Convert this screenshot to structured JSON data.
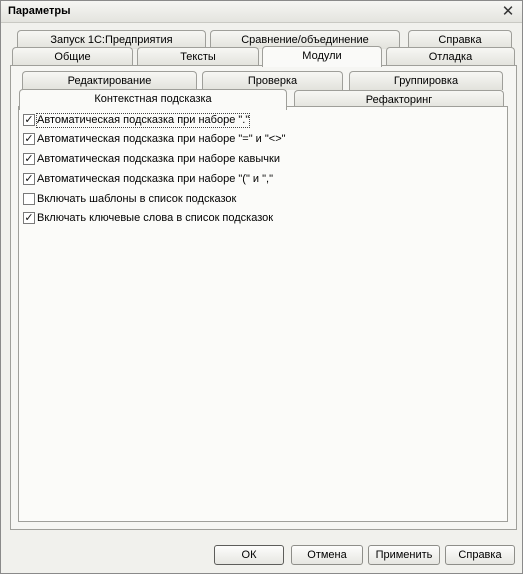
{
  "window": {
    "title": "Параметры",
    "close_glyph": "✕"
  },
  "tabs_row1": [
    {
      "label": "Запуск 1С:Предприятия"
    },
    {
      "label": "Сравнение/объединение"
    },
    {
      "label": "Справка"
    }
  ],
  "tabs_row2": [
    {
      "label": "Общие"
    },
    {
      "label": "Тексты"
    },
    {
      "label": "Модули",
      "active": true
    },
    {
      "label": "Отладка"
    }
  ],
  "subtabs_row1": [
    {
      "label": "Редактирование"
    },
    {
      "label": "Проверка"
    },
    {
      "label": "Группировка"
    }
  ],
  "subtabs_row2": [
    {
      "label": "Контекстная подсказка",
      "active": true
    },
    {
      "label": "Рефакторинг"
    }
  ],
  "options": [
    {
      "label": "Автоматическая подсказка при наборе \".\"",
      "checked": true
    },
    {
      "label": "Автоматическая подсказка при наборе \"=\" и \"<>\"",
      "checked": true
    },
    {
      "label": "Автоматическая подсказка при наборе кавычки",
      "checked": true
    },
    {
      "label": "Автоматическая подсказка при наборе \"(\" и \",\"",
      "checked": true
    },
    {
      "label": "Включать шаблоны в список подсказок",
      "checked": false
    },
    {
      "label": "Включать ключевые слова в список подсказок",
      "checked": true
    }
  ],
  "check_glyph": "✓",
  "buttons": {
    "ok": "ОК",
    "cancel": "Отмена",
    "apply": "Применить",
    "help": "Справка"
  }
}
